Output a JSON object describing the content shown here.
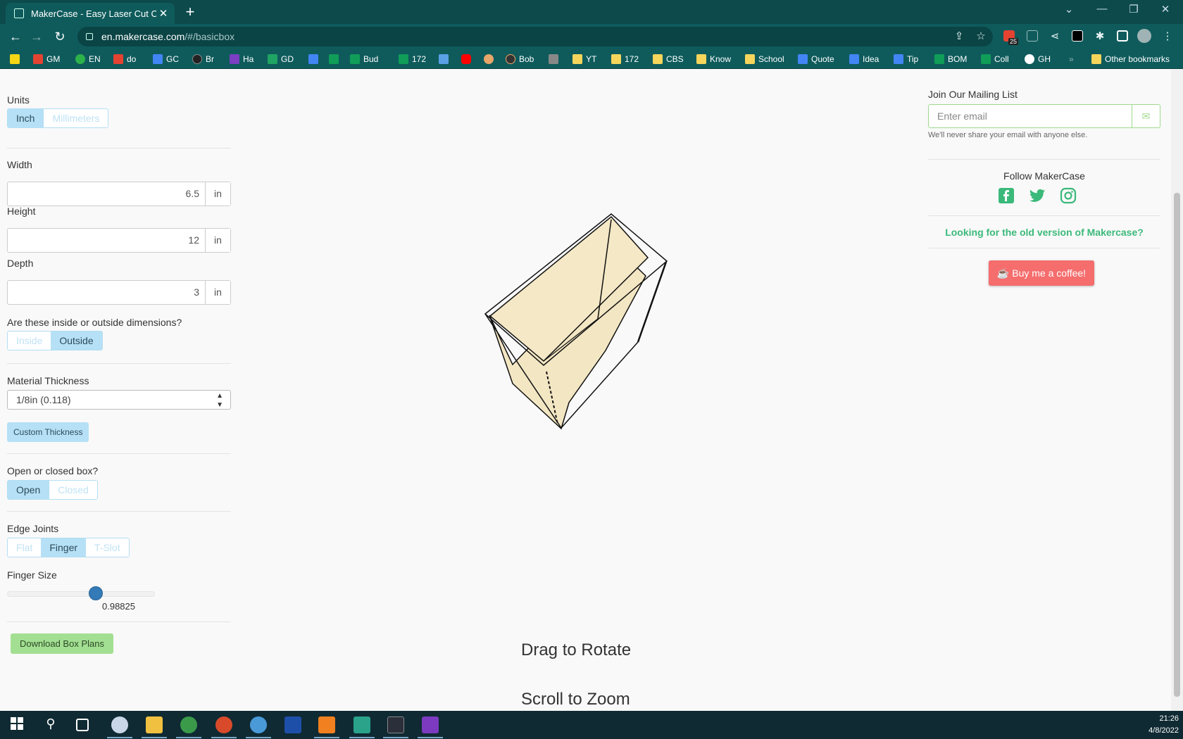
{
  "browser": {
    "tab_title": "MakerCase - Easy Laser Cut Case",
    "url_host": "en.makercase.com",
    "url_path": "/#/basicbox",
    "ext_badge": "25",
    "bookmarks": [
      {
        "label": "GM",
        "color": "#f4c20d"
      },
      {
        "label": "EN",
        "color": "#2db24a"
      },
      {
        "label": "do",
        "color": "#e44332"
      },
      {
        "label": "GC",
        "color": "#4285f4"
      },
      {
        "label": "Br",
        "color": "#222222"
      },
      {
        "label": "Ha",
        "color": "#7a3fc2"
      },
      {
        "label": "GD",
        "color": "#1fa463"
      },
      {
        "label": "",
        "color": "#4285f4"
      },
      {
        "label": "Bud",
        "color": "#0f9d58"
      },
      {
        "label": "172",
        "color": "#0f9d58"
      },
      {
        "label": "",
        "color": "#5aa0e6"
      },
      {
        "label": "",
        "color": "#ff0000"
      },
      {
        "label": "",
        "color": "#e8a66a"
      },
      {
        "label": "Bob",
        "color": "#333333"
      },
      {
        "label": "",
        "color": "#888888"
      },
      {
        "label": "YT",
        "color": "#f5d55b"
      },
      {
        "label": "172",
        "color": "#f5d55b"
      },
      {
        "label": "CBS",
        "color": "#f5d55b"
      },
      {
        "label": "Know",
        "color": "#f5d55b"
      },
      {
        "label": "School",
        "color": "#f5d55b"
      },
      {
        "label": "Quote",
        "color": "#4285f4"
      },
      {
        "label": "Idea",
        "color": "#4285f4"
      },
      {
        "label": "Tip",
        "color": "#4285f4"
      },
      {
        "label": "BOM",
        "color": "#0f9d58"
      },
      {
        "label": "Coll",
        "color": "#0f9d58"
      },
      {
        "label": "GH",
        "color": "#ffffff"
      }
    ],
    "overflow": "»",
    "other_bookmarks": "Other bookmarks"
  },
  "left": {
    "units_label": "Units",
    "units_options": [
      "Inch",
      "Millimeters"
    ],
    "width_label": "Width",
    "width_value": "6.5",
    "height_label": "Height",
    "height_value": "12",
    "depth_label": "Depth",
    "depth_value": "3",
    "unit": "in",
    "dims_question": "Are these inside or outside dimensions?",
    "dims_options": [
      "Inside",
      "Outside"
    ],
    "material_label": "Material Thickness",
    "material_value": "1/8in (0.118)",
    "custom_thickness": "Custom Thickness",
    "open_question": "Open or closed box?",
    "open_options": [
      "Open",
      "Closed"
    ],
    "edge_label": "Edge Joints",
    "edge_options": [
      "Flat",
      "Finger",
      "T-Slot"
    ],
    "finger_label": "Finger Size",
    "finger_value": "0.98825",
    "finger_fraction": 0.6,
    "download": "Download Box Plans"
  },
  "center": {
    "hint_rotate": "Drag to Rotate",
    "hint_zoom": "Scroll to Zoom",
    "box_fill": "#f5e9c8"
  },
  "right": {
    "mailing_title": "Join Our Mailing List",
    "email_placeholder": "Enter email",
    "email_note": "We'll never share your email with anyone else.",
    "follow": "Follow MakerCase",
    "old_version": "Looking for the old version of Makercase?",
    "coffee": "Buy me a coffee!",
    "accent": "#3bb97a"
  },
  "taskbar": {
    "time": "21:26",
    "date": "4/8/2022"
  }
}
